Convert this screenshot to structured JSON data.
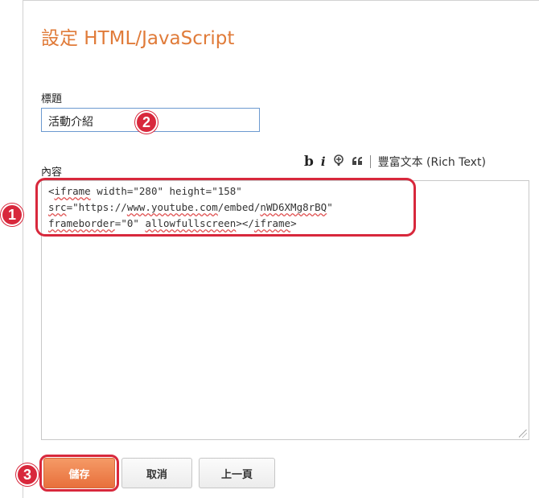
{
  "dialog": {
    "title": "設定 HTML/JavaScript"
  },
  "form": {
    "title_label": "標題",
    "title_value": "活動介紹",
    "content_label": "內容"
  },
  "toolbar": {
    "bold_label": "b",
    "italic_label": "i",
    "rich_text_label": "豐富文本 (Rich Text)"
  },
  "editor": {
    "lines": [
      {
        "pre": "<",
        "sq1": "iframe",
        "mid": " width=\"280\" height=\"158\"",
        "sq2": "",
        "post": ""
      },
      {
        "pre": "",
        "sq1": "src",
        "mid": "=\"https://",
        "sq2": "www.youtube.com",
        "post": "/embed/"
      },
      {
        "pre": "",
        "sq1": "frameborder",
        "mid": "=\"0\" ",
        "sq2": "allowfullscreen",
        "post": "></"
      }
    ],
    "line2_tail_sq": "nWD6XMg8rBQ",
    "line2_tail_end": "\"",
    "line3_tail_sq": "iframe",
    "line3_tail_end": ">"
  },
  "buttons": {
    "save": "儲存",
    "cancel": "取消",
    "back": "上一頁"
  },
  "callouts": {
    "one": "1",
    "two": "2",
    "three": "3"
  },
  "colors": {
    "accent": "#e07b39",
    "callout": "#d8283c",
    "save_button": "#e8703c"
  }
}
